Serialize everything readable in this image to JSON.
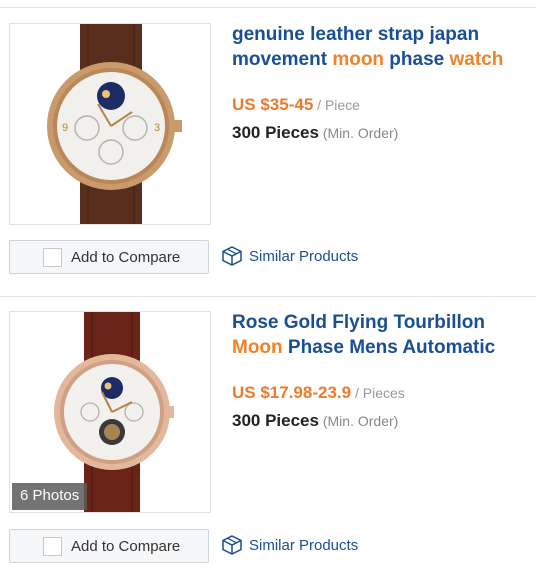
{
  "products": [
    {
      "title": [
        {
          "text": "genuine leather strap japan movement ",
          "hl": false
        },
        {
          "text": "moon",
          "hl": true
        },
        {
          "text": " phase ",
          "hl": false
        },
        {
          "text": "watch",
          "hl": true
        }
      ],
      "price": "US $35-45",
      "price_unit": " / Piece",
      "min_qty": "300 Pieces",
      "min_note": " (Min. Order)",
      "photos_badge": "",
      "compare_label": "Add to Compare",
      "similar_label": "Similar Products"
    },
    {
      "title": [
        {
          "text": "Rose Gold Flying Tourbillon ",
          "hl": false
        },
        {
          "text": "Moon",
          "hl": true
        },
        {
          "text": " Phase Mens Automatic",
          "hl": false
        }
      ],
      "price": "US $17.98-23.9",
      "price_unit": " / Pieces",
      "min_qty": "300 Pieces",
      "min_note": " (Min. Order)",
      "photos_badge": "6 Photos",
      "compare_label": "Add to Compare",
      "similar_label": "Similar Products"
    }
  ],
  "colors": {
    "title_blue": "#1b4f93",
    "highlight_orange": "#f08228",
    "price_orange": "#ee7b2c"
  }
}
